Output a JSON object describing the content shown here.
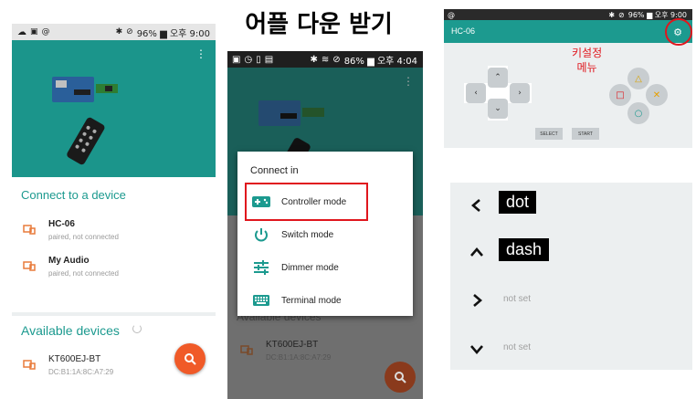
{
  "title": "어플 다운 받기",
  "panel1": {
    "status_right": "96% ▆ 오후 9:00",
    "section_connect": "Connect to a device",
    "paired_devices": [
      {
        "name": "HC-06",
        "status": "paired, not connected"
      },
      {
        "name": "My Audio",
        "status": "paired, not connected"
      }
    ],
    "section_available": "Available devices",
    "available_devices": [
      {
        "name": "KT600EJ-BT",
        "address": "DC:B1:1A:8C:A7:29"
      }
    ],
    "colors": {
      "accent": "#1c9a8f",
      "fab": "#f05a28",
      "icon": "#e87b3b"
    }
  },
  "panel2": {
    "status_right": "86% ▆ 오후 4:04",
    "dialog_title": "Connect in",
    "modes": [
      {
        "label": "Controller mode",
        "icon": "gamepad-icon"
      },
      {
        "label": "Switch mode",
        "icon": "power-icon"
      },
      {
        "label": "Dimmer mode",
        "icon": "sliders-icon"
      },
      {
        "label": "Terminal mode",
        "icon": "keyboard-icon"
      }
    ],
    "bg_available": "Available devices",
    "bg_device": "KT600EJ-BT",
    "bg_address": "DC:B1:1A:8C:A7:29",
    "highlight_color": "#e0161d"
  },
  "panel3": {
    "status_right": "96% ▆ 오후 9:00",
    "app_title": "HC-06",
    "annotation": "키설정\n메뉴",
    "annotation_line1": "키설정",
    "annotation_line2": "메뉴",
    "select_label": "SELECT",
    "start_label": "START",
    "face_buttons": {
      "triangle": "△",
      "square": "□",
      "cross": "✕",
      "circle": "○"
    }
  },
  "panel4": {
    "keys": [
      {
        "direction": "left",
        "label": "dot",
        "set": true
      },
      {
        "direction": "up",
        "label": "dash",
        "set": true
      },
      {
        "direction": "right",
        "label": "not set",
        "set": false
      },
      {
        "direction": "down",
        "label": "not set",
        "set": false
      }
    ]
  }
}
